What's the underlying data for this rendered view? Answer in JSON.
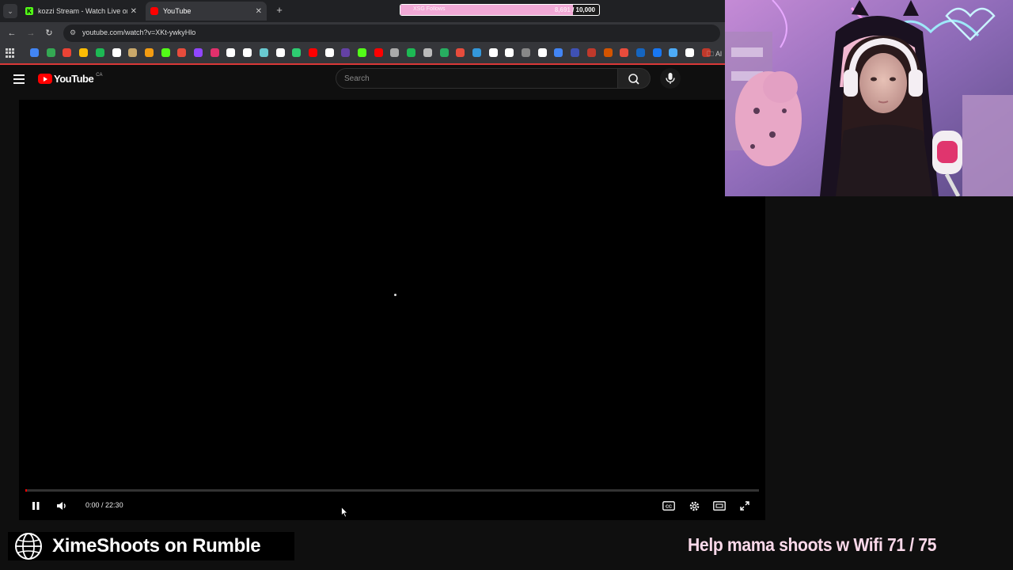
{
  "browser": {
    "tabs": [
      {
        "title": "kozzi Stream - Watch Live on K",
        "favicon": "kick-icon",
        "active": false
      },
      {
        "title": "YouTube",
        "favicon": "youtube-icon",
        "active": true
      }
    ],
    "url": "youtube.com/watch?v=XKt-ywkyHlo",
    "bookmarks_folder_label": "Al",
    "bookmark_colors": [
      "#4285f4",
      "#34a853",
      "#ea4335",
      "#fbbc04",
      "#1db954",
      "#ffffff",
      "#c9a86a",
      "#f39c12",
      "#53fc18",
      "#e74c3c",
      "#9146ff",
      "#e1306c",
      "#ffffff",
      "#ffffff",
      "#69c9d0",
      "#ffffff",
      "#2ecc71",
      "#ff0000",
      "#ffffff",
      "#6441a5",
      "#53fc18",
      "#ff0000",
      "#aaaaaa",
      "#1db954",
      "#bbbbbb",
      "#27ae60",
      "#e74c3c",
      "#3498db",
      "#ffffff",
      "#ffffff",
      "#888888",
      "#ffffff",
      "#4285f4",
      "#3f51b5",
      "#c0392b",
      "#d35400",
      "#e74c3c",
      "#1565c0",
      "#1877f2",
      "#4dabf7",
      "#ffffff",
      "#c0392b"
    ]
  },
  "stream_goal": {
    "label": "XSG Follows",
    "current": "8,691",
    "target": "10,000",
    "fill_fraction": 0.869
  },
  "youtube": {
    "logo_text": "YouTube",
    "country_code": "CA",
    "search_placeholder": "Search",
    "player": {
      "time_current": "0:00",
      "time_total": "22:30",
      "progress_fraction": 0.002
    }
  },
  "overlay": {
    "rumble_text": "XimeShoots on Rumble",
    "wifi_goal_text": "Help mama shoots w Wifi  71 / 75"
  },
  "colors": {
    "youtube_red": "#ff0000",
    "goal_pink": "#f1a9d6",
    "kick_green": "#53fc18"
  }
}
